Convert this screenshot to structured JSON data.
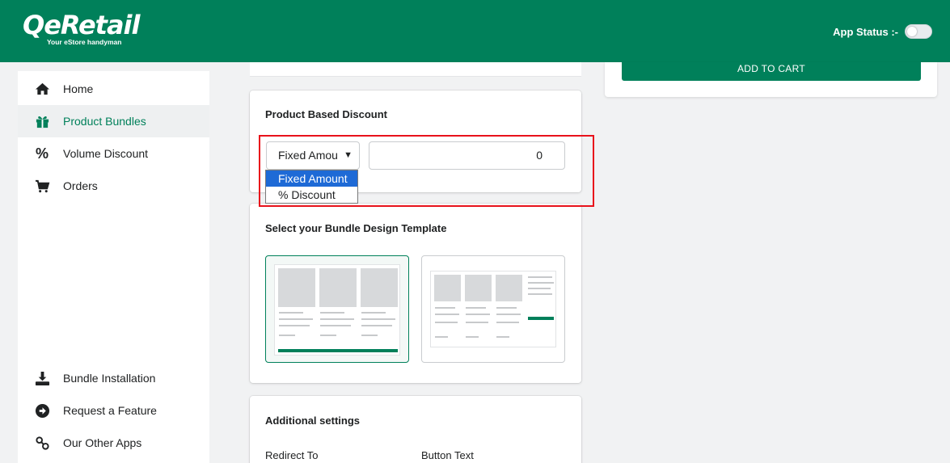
{
  "header": {
    "logo_text": "QeRetail",
    "logo_tagline": "Your eStore handyman",
    "app_status_label": "App Status :-",
    "app_status_on": false
  },
  "sidebar": {
    "items": [
      {
        "label": "Home",
        "icon": "home-icon"
      },
      {
        "label": "Product Bundles",
        "icon": "gift-icon",
        "active": true
      },
      {
        "label": "Volume Discount",
        "icon": "percent-icon"
      },
      {
        "label": "Orders",
        "icon": "cart-icon"
      },
      {
        "label": "Bundle Installation",
        "icon": "download-icon"
      },
      {
        "label": "Request a Feature",
        "icon": "arrow-circle-icon"
      },
      {
        "label": "Our Other Apps",
        "icon": "link-icon"
      }
    ]
  },
  "preview": {
    "add_to_cart_label": "ADD TO CART"
  },
  "discount": {
    "title": "Product Based Discount",
    "selected_type": "Fixed Amou",
    "value": "0",
    "options": [
      "Fixed Amount",
      "% Discount"
    ]
  },
  "templates": {
    "title": "Select your Bundle Design Template"
  },
  "additional": {
    "title": "Additional settings",
    "redirect_label": "Redirect To",
    "button_text_label": "Button Text"
  },
  "colors": {
    "brand": "#00805a",
    "highlight": "#e8121b",
    "dropdown_selected": "#1e6ad6"
  }
}
